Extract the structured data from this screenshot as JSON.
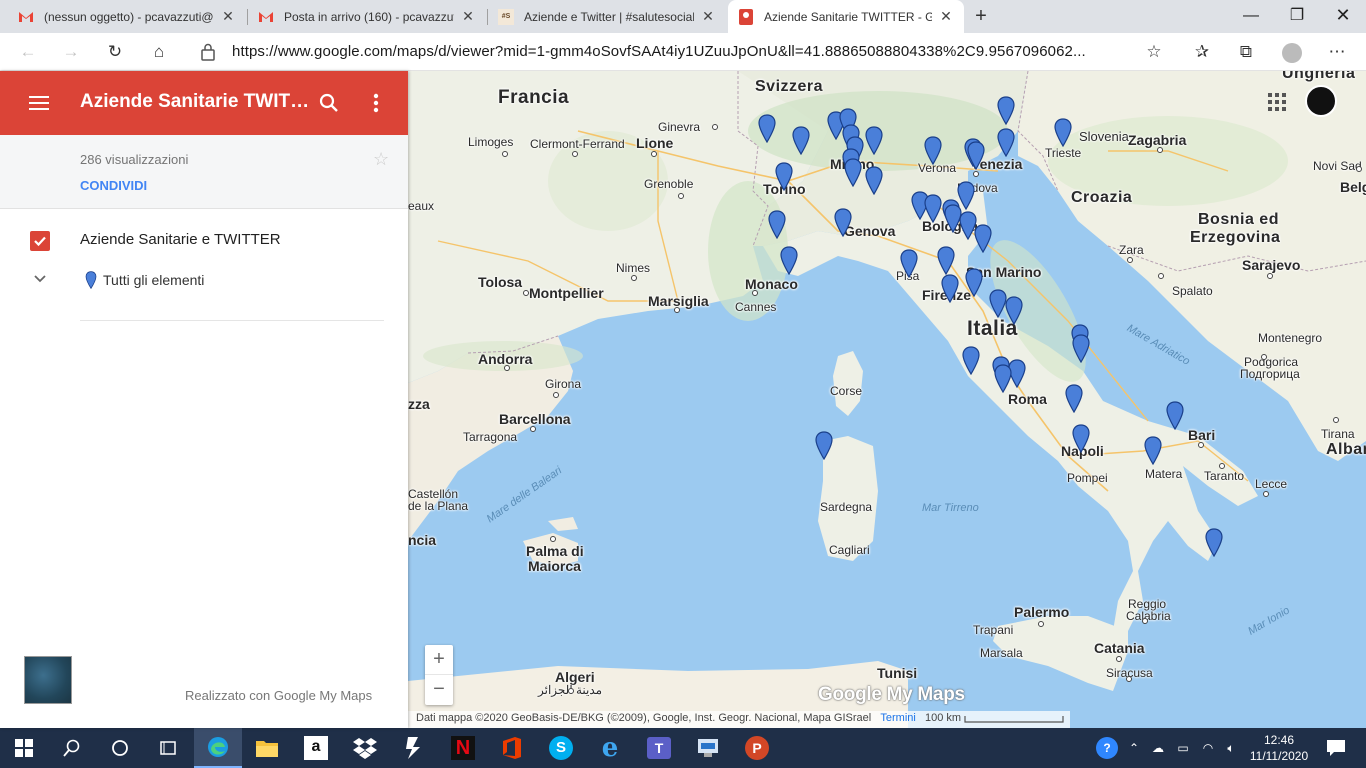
{
  "browser": {
    "tabs": [
      {
        "title": "(nessun oggetto) - pcavazzuti@",
        "icon": "gmail-icon",
        "active": false
      },
      {
        "title": "Posta in arrivo (160) - pcavazzuti",
        "icon": "gmail-icon",
        "active": false
      },
      {
        "title": "Aziende e Twitter | #salutesocial",
        "icon": "site-icon",
        "active": false
      },
      {
        "title": "Aziende Sanitarie TWITTER - Goo",
        "icon": "maps-pin-icon",
        "active": true
      }
    ],
    "url": "https://www.google.com/maps/d/viewer?mid=1-gmm4oSovfSAAt4iy1UZuuJpOnU&ll=41.88865088804338%2C9.9567096062..."
  },
  "panel": {
    "title": "Aziende Sanitarie TWITTER",
    "views": "286 visualizzazioni",
    "share": "CONDIVIDI",
    "layer_title": "Aziende Sanitarie e TWITTER",
    "layer_item": "Tutti gli elementi",
    "made_with": "Realizzato con Google My Maps",
    "accent_color": "#db4437"
  },
  "map": {
    "labels": {
      "francia": "Francia",
      "svizzera": "Svizzera",
      "ungheria": "Ungheria",
      "slovenia": "Slovenia",
      "croazia": "Croazia",
      "bosnia1": "Bosnia ed",
      "bosnia2": "Erzegovina",
      "italia": "Italia",
      "montenegro": "Montenegro",
      "albania": "Alban",
      "ginevra": "Ginevra",
      "lione": "Lione",
      "limoges": "Limoges",
      "clermont": "Clermont-Ferrand",
      "grenoble": "Grenoble",
      "torino": "Torino",
      "milano": "Milano",
      "verona": "Verona",
      "venezia": "Venezia",
      "padova": "Padova",
      "trieste": "Trieste",
      "zagabria": "Zagabria",
      "novisad": "Novi Sad",
      "belg": "Belg",
      "genova": "Genova",
      "bologna": "Bologna",
      "zara": "Zara",
      "sarajevo": "Sarajevo",
      "nimes": "Nimes",
      "tolosa": "Tolosa",
      "montpellier": "Montpellier",
      "marsiglia": "Marsiglia",
      "monaco": "Monaco",
      "cannes": "Cannes",
      "pisa": "Pisa",
      "firenze": "Firenze",
      "sanmarino": "San Marino",
      "spalato": "Spalato",
      "andorra": "Andorra",
      "girona": "Girona",
      "barcellona": "Barcellona",
      "tarragona": "Tarragona",
      "corse": "Corse",
      "roma": "Roma",
      "podgorica1": "Podgorica",
      "podgorica2": "Подгорица",
      "bari": "Bari",
      "tirana": "Tirana",
      "napoli": "Napoli",
      "pompei": "Pompei",
      "matera": "Matera",
      "taranto": "Taranto",
      "lecce": "Lecce",
      "sardegna": "Sardegna",
      "cagliari": "Cagliari",
      "castellon1": "Castellón",
      "castellon2": "de la Plana",
      "palma1": "Palma di",
      "palma2": "Maiorca",
      "palermo": "Palermo",
      "trapani": "Trapani",
      "reggio1": "Reggio",
      "reggio2": "Calabria",
      "catania": "Catania",
      "marsala": "Marsala",
      "siracusa": "Siracusa",
      "tunisi": "Tunisi",
      "algeri1": "Algeri",
      "algeri2": "مدينة الجزائر",
      "zza": "zza",
      "eaux": "eaux",
      "ncia": "ncia",
      "marebaleari": "Mare delle Baleari",
      "maretirreno": "Mar Tirreno",
      "mareadriatico": "Mare Adriatico",
      "mareionio": "Mar Ionio"
    },
    "attribution": "Dati mappa ©2020 GeoBasis-DE/BKG (©2009), Google, Inst. Geogr. Nacional, Mapa GISrael",
    "terms": "Termini",
    "scale": "100 km",
    "logo": "Google My Maps",
    "marker_color": "#4a7fd9"
  },
  "taskbar": {
    "time": "12:46",
    "date": "11/11/2020",
    "apps": [
      "start-icon",
      "search-icon",
      "cortana-icon",
      "task-view-icon",
      "edge-icon",
      "file-explorer-icon",
      "amazon-icon",
      "dropbox-icon",
      "power-automate-icon",
      "netflix-icon",
      "office-icon",
      "skype-icon",
      "internet-explorer-icon",
      "teams-icon",
      "remote-desktop-icon",
      "powerpoint-icon"
    ]
  }
}
